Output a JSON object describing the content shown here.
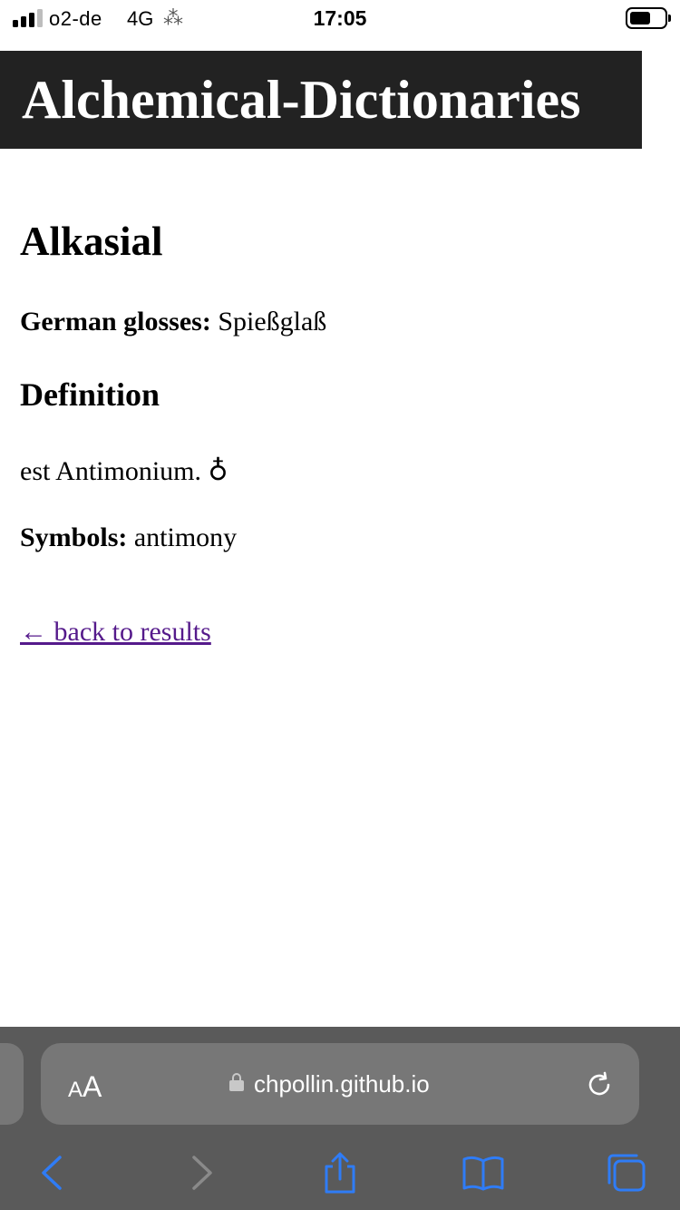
{
  "status_bar": {
    "carrier": "o2-de",
    "network": "4G",
    "time": "17:05"
  },
  "header": {
    "title": "Alchemical-Dictionaries"
  },
  "entry": {
    "title": "Alkasial",
    "glosses_label": "German glosses:",
    "glosses_value": "Spießglaß",
    "definition_heading": "Definition",
    "definition_text": "est Antimonium. ♁",
    "symbols_label": "Symbols:",
    "symbols_value": "antimony",
    "back_link": "← back to results"
  },
  "browser": {
    "text_size_label_small": "A",
    "text_size_label_big": "A",
    "url": "chpollin.github.io",
    "icons": [
      "lock-icon",
      "reload-icon",
      "back-icon",
      "forward-icon",
      "share-icon",
      "bookmarks-icon",
      "tabs-icon"
    ],
    "accent_color": "#2f7cf6",
    "disabled_color": "#8a8a8a"
  }
}
